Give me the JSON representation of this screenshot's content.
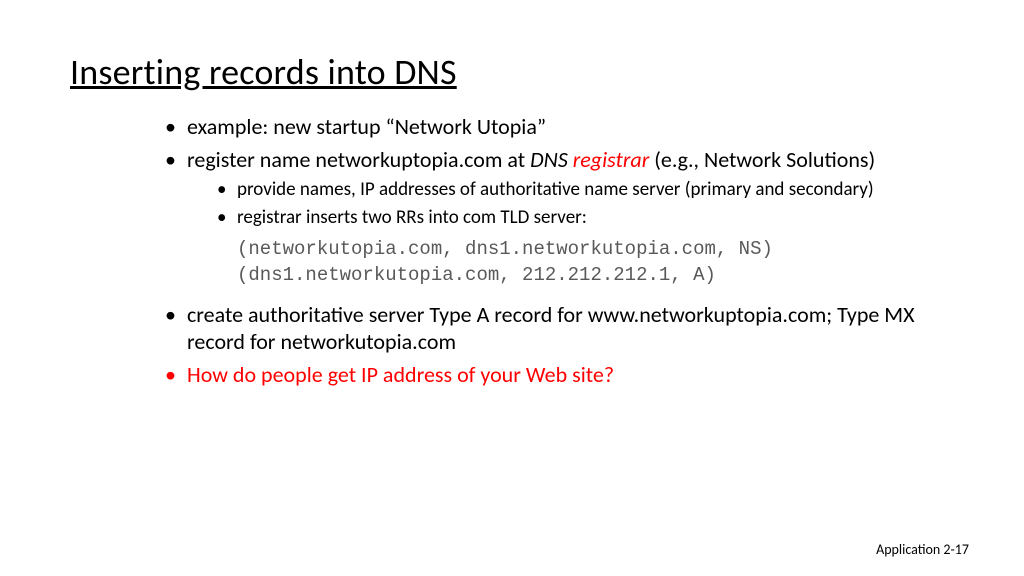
{
  "title": "Inserting records into DNS",
  "bullets": {
    "b1": "example: new startup “Network Utopia”",
    "b2_pre": "register name networkuptopia.com at ",
    "b2_dns": "DNS ",
    "b2_reg": "registrar",
    "b2_post": " (e.g., Network Solutions)",
    "b2_s1": "provide names, IP addresses of authoritative name server (primary and secondary)",
    "b2_s2": "registrar inserts two RRs into com TLD server:",
    "code_l1": "(networkutopia.com, dns1.networkutopia.com, NS)",
    "code_l2": "(dns1.networkutopia.com, 212.212.212.1, A)",
    "b3": "create authoritative server Type A record for www.networkuptopia.com; Type MX record for networkutopia.com",
    "b4": "How do people get IP address of your Web site?"
  },
  "footer": "Application  2-17"
}
